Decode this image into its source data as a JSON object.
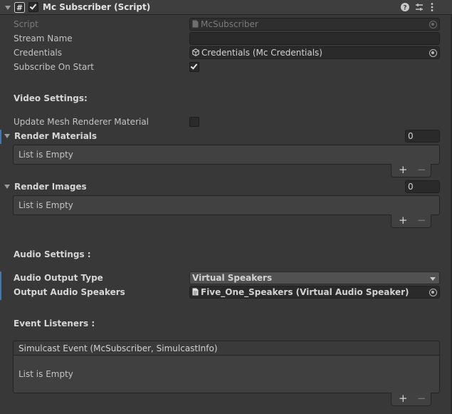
{
  "component": {
    "title": "Mc Subscriber (Script)",
    "enabled": true
  },
  "fields": {
    "script": {
      "label": "Script",
      "value": "McSubscriber"
    },
    "stream_name": {
      "label": "Stream Name",
      "value": ""
    },
    "credentials": {
      "label": "Credentials",
      "value": "Credentials (Mc Credentials)"
    },
    "subscribe_on_start": {
      "label": "Subscribe On Start",
      "checked": true
    }
  },
  "video": {
    "header": "Video Settings:",
    "update_mesh": {
      "label": "Update Mesh Renderer Material",
      "checked": false
    },
    "render_materials": {
      "label": "Render Materials",
      "count": "0",
      "empty_text": "List is Empty"
    },
    "render_images": {
      "label": "Render Images",
      "count": "0",
      "empty_text": "List is Empty"
    }
  },
  "audio": {
    "header": "Audio Settings :",
    "output_type": {
      "label": "Audio Output Type",
      "value": "Virtual Speakers"
    },
    "output_speakers": {
      "label": "Output Audio Speakers",
      "value": "Five_One_Speakers (Virtual Audio Speaker)"
    }
  },
  "events": {
    "header": "Event Listeners :",
    "event_title": "Simulcast Event (McSubscriber, SimulcastInfo)",
    "empty_text": "List is Empty"
  },
  "list_controls": {
    "plus": "+",
    "minus": "−"
  },
  "icons": [
    "foldout-arrow-icon",
    "script-icon",
    "help-icon",
    "preset-icon",
    "kebab-menu-icon",
    "object-picker-icon",
    "scriptable-object-icon",
    "asset-file-icon"
  ]
}
